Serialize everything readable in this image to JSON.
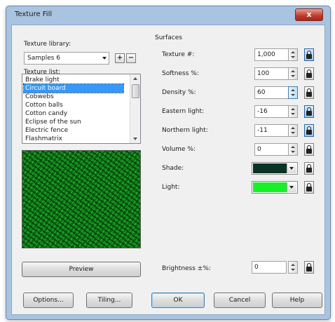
{
  "dialog": {
    "title": "Texture Fill",
    "close_glyph": "x"
  },
  "library": {
    "label": "Texture library:",
    "selected": "Samples 6",
    "add_glyph": "+",
    "remove_glyph": "−"
  },
  "texture_list": {
    "label": "Texture list:",
    "items": [
      "Brake light",
      "Circuit board",
      "Cobwebs",
      "Cotton balls",
      "Cotton candy",
      "Eclipse of the sun",
      "Electric fence",
      "Flashmatrix"
    ],
    "selected_index": 1
  },
  "preview_button": "Preview",
  "surfaces": {
    "heading": "Surfaces",
    "texture_label": "Texture #:",
    "texture_value": "1,000",
    "softness_label": "Softness %:",
    "softness_value": "100",
    "density_label": "Density %:",
    "density_value": "60",
    "eastern_label": "Eastern light:",
    "eastern_value": "-16",
    "northern_label": "Northern light:",
    "northern_value": "-11",
    "volume_label": "Volume %:",
    "volume_value": "0",
    "shade_label": "Shade:",
    "shade_color": "#0b3325",
    "light_label": "Light:",
    "light_color": "#18f027",
    "brightness_label": "Brightness ±%:",
    "brightness_value": "0"
  },
  "buttons": {
    "options": "Options...",
    "tiling": "Tiling...",
    "ok": "OK",
    "cancel": "Cancel",
    "help": "Help"
  }
}
